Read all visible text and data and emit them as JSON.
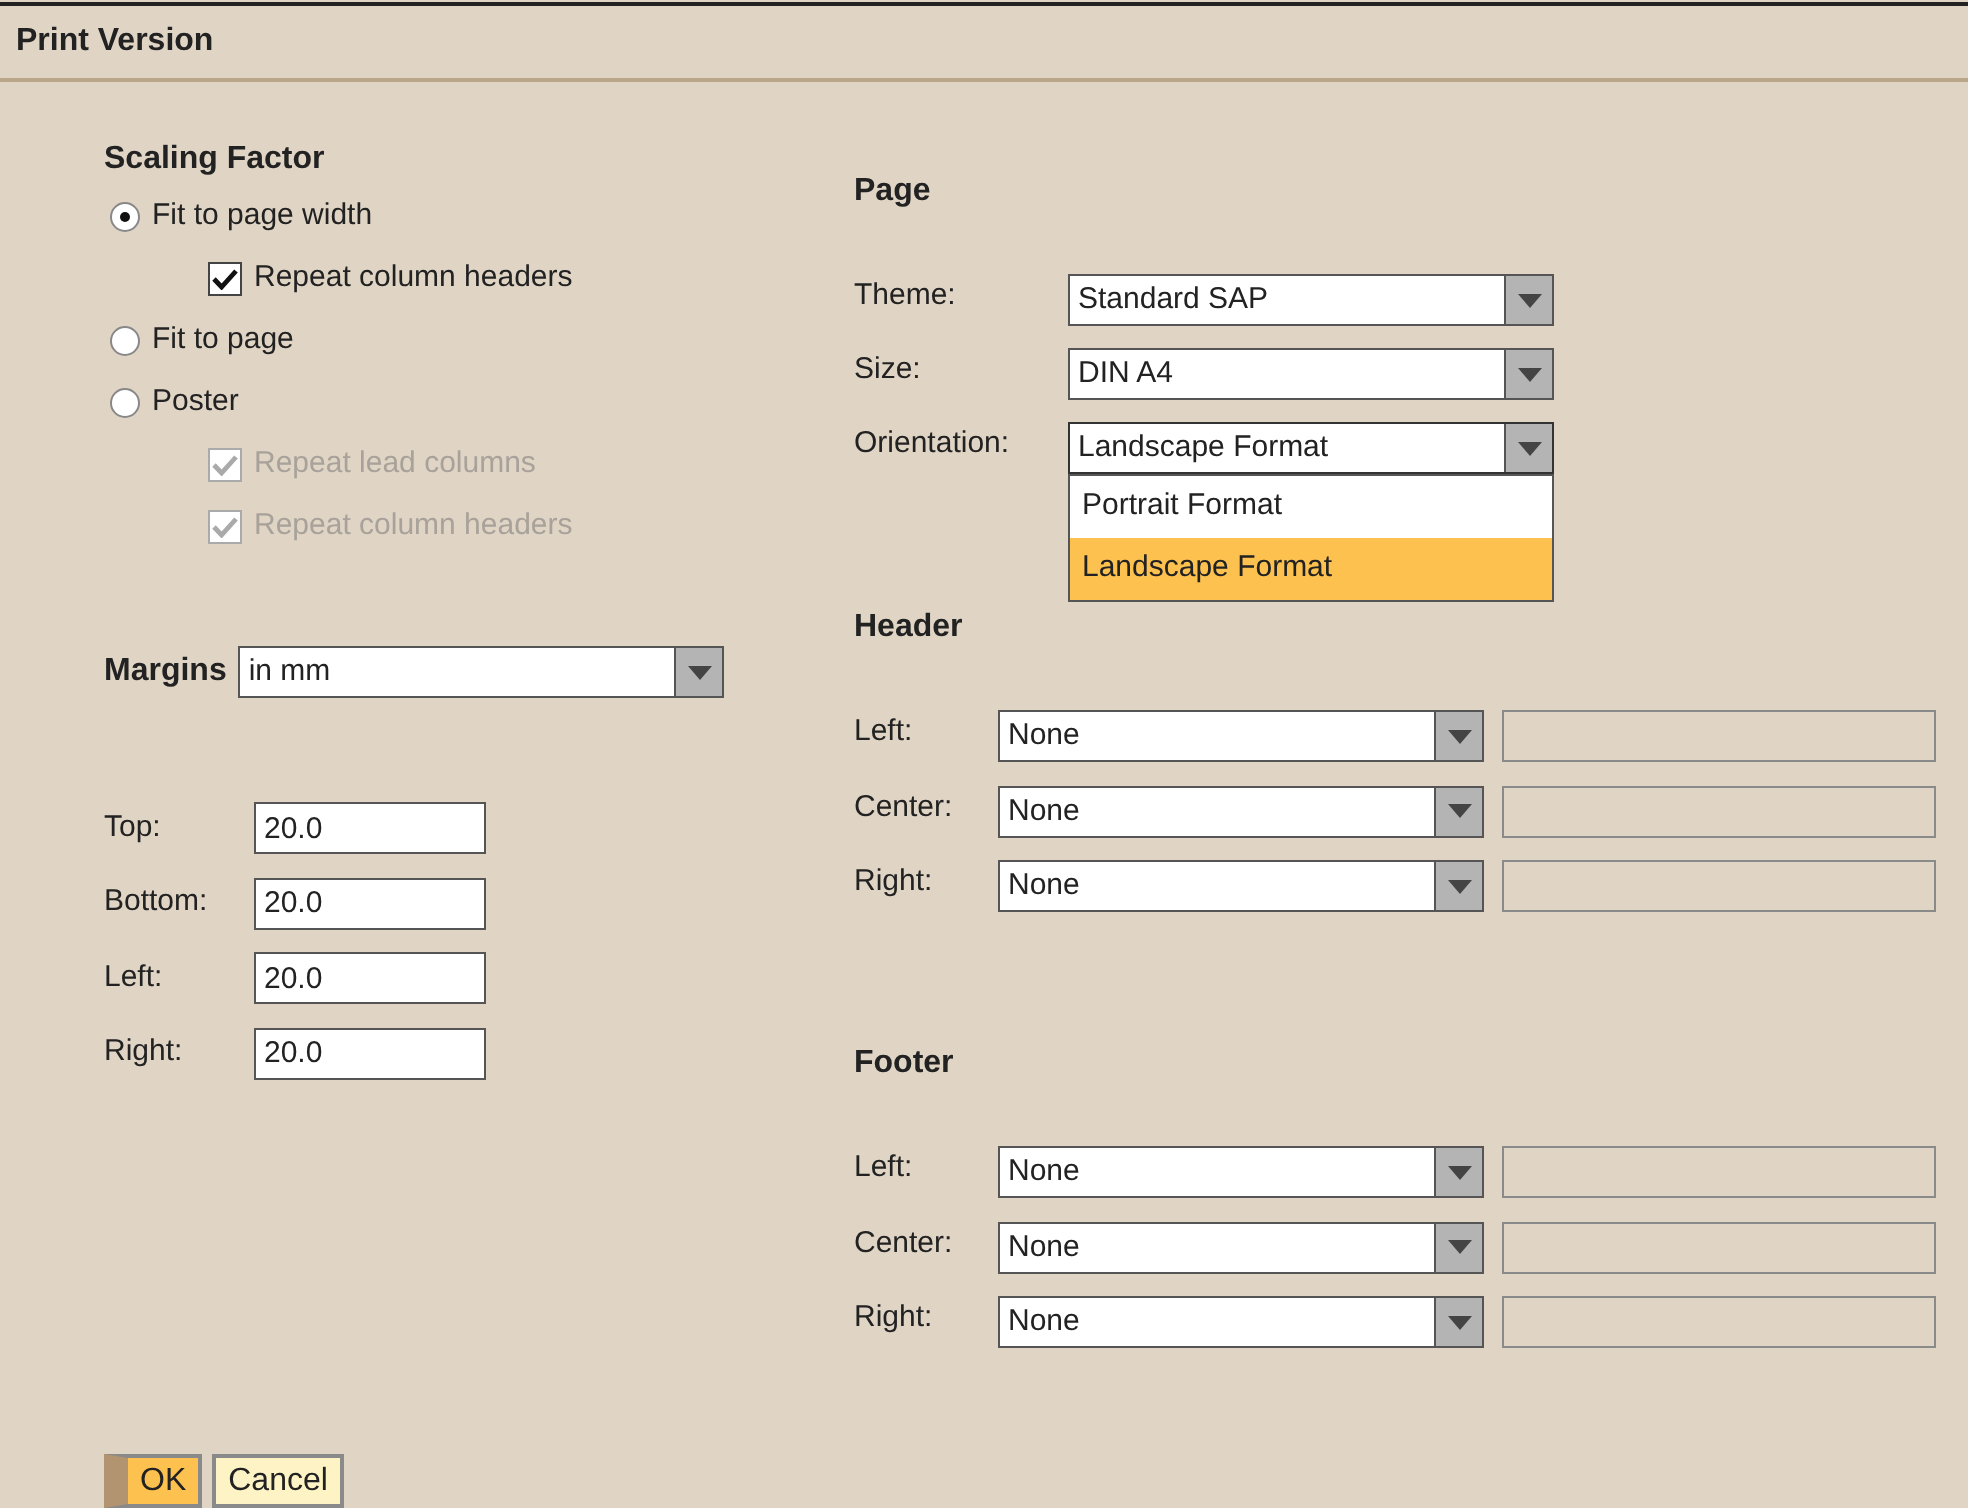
{
  "window": {
    "title": "Print Version"
  },
  "scaling_factor": {
    "title": "Scaling Factor",
    "options": [
      {
        "kind": "radio",
        "label": "Fit to page width",
        "selected": true,
        "children": [
          {
            "kind": "checkbox",
            "label": "Repeat column headers",
            "checked": true,
            "disabled": false
          }
        ]
      },
      {
        "kind": "radio",
        "label": "Fit to page",
        "selected": false
      },
      {
        "kind": "radio",
        "label": "Poster",
        "selected": false,
        "children": [
          {
            "kind": "checkbox",
            "label": "Repeat lead columns",
            "checked": true,
            "disabled": true
          },
          {
            "kind": "checkbox",
            "label": "Repeat column headers",
            "checked": true,
            "disabled": true
          }
        ]
      }
    ]
  },
  "margins": {
    "label": "Margins",
    "unit": {
      "value": "in mm",
      "expanded": false
    },
    "fields": [
      {
        "label": "Top:",
        "value": "20.0"
      },
      {
        "label": "Bottom:",
        "value": "20.0"
      },
      {
        "label": "Left:",
        "value": "20.0"
      },
      {
        "label": "Right:",
        "value": "20.0"
      }
    ]
  },
  "page": {
    "title": "Page",
    "fields": [
      {
        "label": "Theme:",
        "value": "Standard SAP",
        "expanded": false
      },
      {
        "label": "Size:",
        "value": "DIN A4",
        "expanded": false
      },
      {
        "label": "Orientation:",
        "value": "Landscape Format",
        "expanded": true,
        "options": [
          {
            "label": "Portrait Format",
            "selected": false
          },
          {
            "label": "Landscape Format",
            "selected": true
          }
        ]
      }
    ]
  },
  "header": {
    "title": "Header",
    "rows": [
      {
        "label": "Left:",
        "value": "None",
        "expanded": false
      },
      {
        "label": "Center:",
        "value": "None",
        "expanded": false
      },
      {
        "label": "Right:",
        "value": "None",
        "expanded": false
      }
    ]
  },
  "footer": {
    "title": "Footer",
    "rows": [
      {
        "label": "Left:",
        "value": "None",
        "expanded": false
      },
      {
        "label": "Center:",
        "value": "None",
        "expanded": false
      },
      {
        "label": "Right:",
        "value": "None",
        "expanded": false
      }
    ]
  },
  "buttons": [
    {
      "label": "OK",
      "kind": "primary"
    },
    {
      "label": "Cancel",
      "kind": "default"
    }
  ]
}
